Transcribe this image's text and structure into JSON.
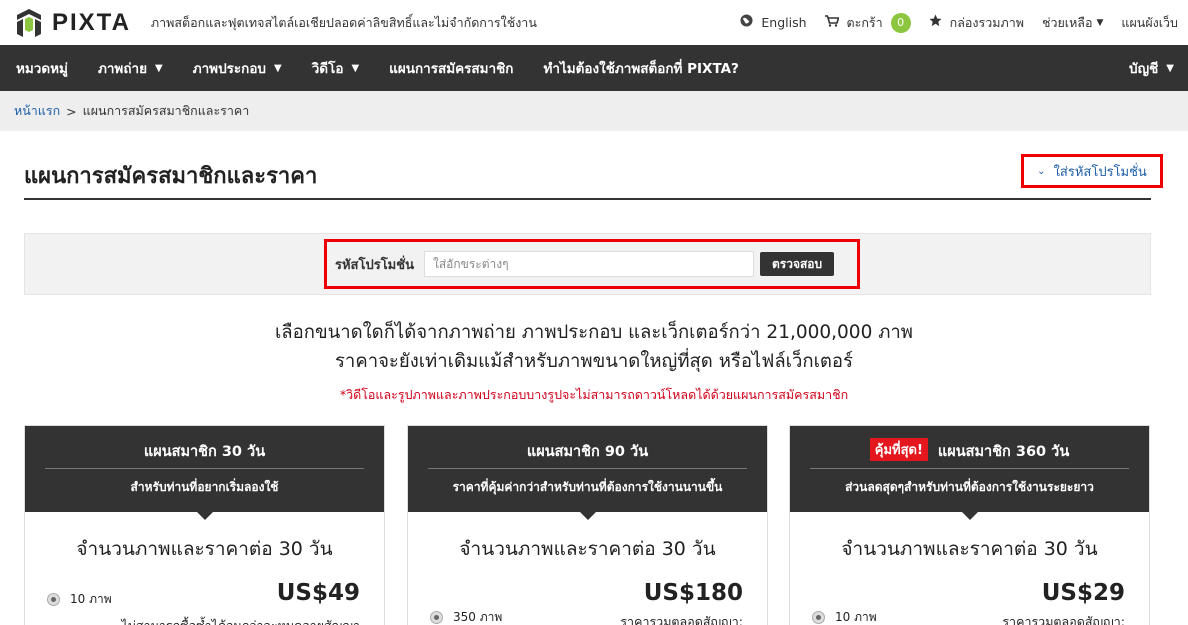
{
  "header": {
    "logo_text": "PIXTA",
    "tagline": "ภาพสต็อกและฟุตเทจสไตล์เอเชียปลอดค่าลิขสิทธิ์และไม่จำกัดการใช้งาน",
    "language": "English",
    "cart_label": "ตะกร้า",
    "cart_count": "0",
    "lightbox": "กล่องรวมภาพ",
    "help": "ช่วยเหลือ",
    "sitemap": "แผนผังเว็บ"
  },
  "nav": {
    "items": [
      "หมวดหมู่",
      "ภาพถ่าย",
      "ภาพประกอบ",
      "วิดีโอ",
      "แผนการสมัครสมาชิก",
      "ทำไมต้องใช้ภาพสต็อกที่ PIXTA?"
    ],
    "account": "บัญชี"
  },
  "breadcrumb": {
    "home": "หน้าแรก",
    "sep": ">",
    "current": "แผนการสมัครสมาชิกและราคา"
  },
  "page": {
    "title": "แผนการสมัครสมาชิกและราคา",
    "promo_toggle": "ใส่รหัสโปรโมชั่น"
  },
  "promo": {
    "label": "รหัสโปรโมชั่น",
    "placeholder": "ใส่อักขระต่างๆ",
    "button": "ตรวจสอบ"
  },
  "intro": {
    "line1": "เลือกขนาดใดก็ได้จากภาพถ่าย ภาพประกอบ และเว็กเตอร์กว่า 21,000,000 ภาพ",
    "line2": "ราคาจะยังเท่าเดิมแม้สำหรับภาพขนาดใหญ่ที่สุด หรือไฟล์เว็กเตอร์",
    "notice": "*วิดีโอและรูปภาพและภาพประกอบบางรูปจะไม่สามารถดาวน์โหลดได้ด้วยแผนการสมัครสมาชิก"
  },
  "plans": [
    {
      "title": "แผนสมาชิก 30 วัน",
      "subtitle": "สำหรับท่านที่อยากเริ่มลองใช้",
      "body_title": "จำนวนภาพและราคาต่อ 30 วัน",
      "option": "10 ภาพ",
      "price": "US$49",
      "note": "ไม่สามารถซื้อซ้ำได้จนกว่าจะหมดอายุสัญญา"
    },
    {
      "title": "แผนสมาชิก 90 วัน",
      "subtitle": "ราคาที่คุ้มค่ากว่าสำหรับท่านที่ต้องการใช้งานนานขึ้น",
      "body_title": "จำนวนภาพและราคาต่อ 30 วัน",
      "option": "350 ภาพ",
      "price": "US$180",
      "note": "ราคารวมตลอดสัญญา:"
    },
    {
      "badge": "คุ้มที่สุด!",
      "title": "แผนสมาชิก 360 วัน",
      "subtitle": "ส่วนลดสุดๆสำหรับท่านที่ต้องการใช้งานระยะยาว",
      "body_title": "จำนวนภาพและราคาต่อ 30 วัน",
      "option": "10 ภาพ",
      "price": "US$29",
      "note": "ราคารวมตลอดสัญญา:"
    }
  ],
  "icons": {
    "globe": "globe-icon",
    "cart": "cart-icon",
    "star": "star-icon",
    "chevron": "chevron-down-icon"
  },
  "colors": {
    "nav_bg": "#333333",
    "link": "#1f5fa8",
    "badge_green": "#8cc63f",
    "highlight_red": "#e00000",
    "best_badge": "#e4161e"
  }
}
